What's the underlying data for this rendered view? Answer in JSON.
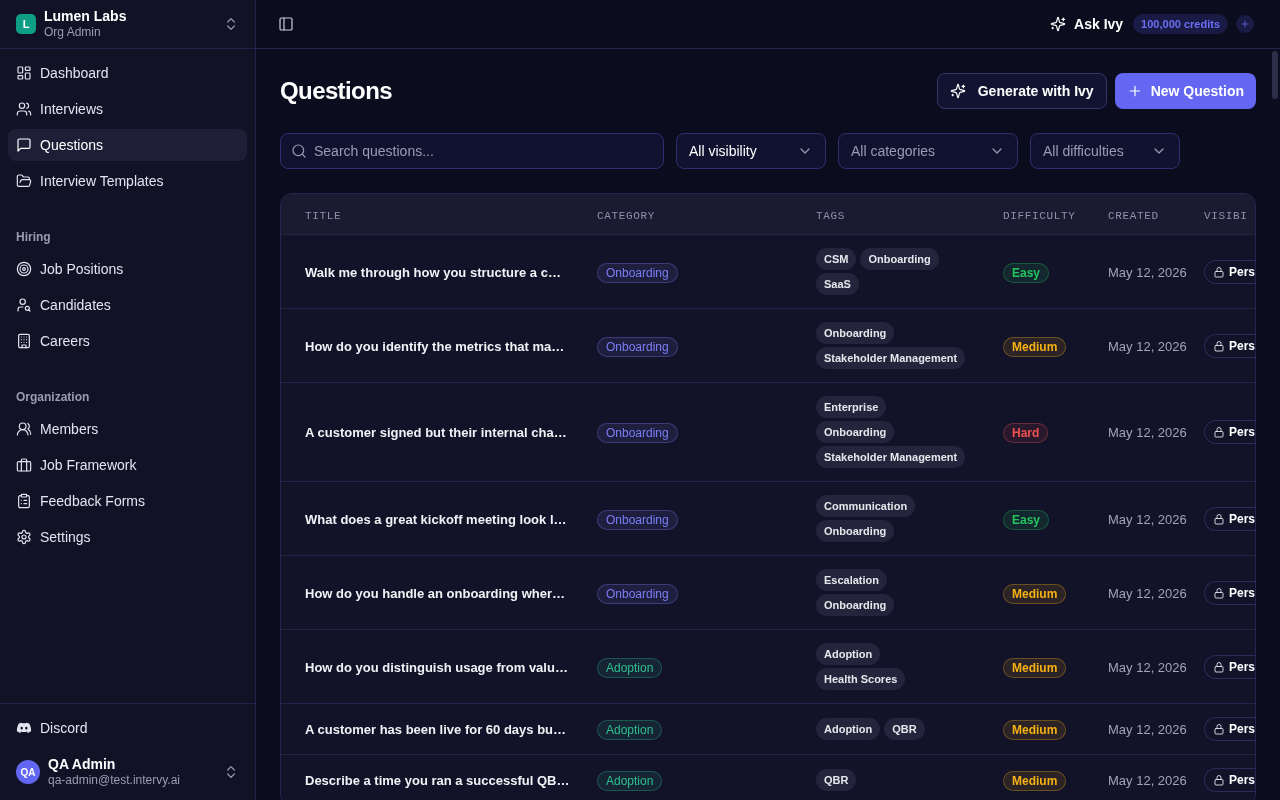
{
  "sidebar": {
    "org": {
      "initial": "L",
      "name": "Lumen Labs",
      "role": "Org Admin"
    },
    "sections": [
      {
        "items": [
          {
            "label": "Dashboard",
            "selected": false
          },
          {
            "label": "Interviews",
            "selected": false
          },
          {
            "label": "Questions",
            "selected": true
          },
          {
            "label": "Interview Templates",
            "selected": false
          }
        ]
      },
      {
        "title": "Hiring",
        "items": [
          {
            "label": "Job Positions",
            "selected": false
          },
          {
            "label": "Candidates",
            "selected": false
          },
          {
            "label": "Careers",
            "selected": false
          }
        ]
      },
      {
        "title": "Organization",
        "items": [
          {
            "label": "Members",
            "selected": false
          },
          {
            "label": "Job Framework",
            "selected": false
          },
          {
            "label": "Feedback Forms",
            "selected": false
          },
          {
            "label": "Settings",
            "selected": false
          }
        ]
      }
    ],
    "footer": {
      "link": "Discord",
      "user": {
        "initials": "QA",
        "name": "QA Admin",
        "email": "qa-admin@test.intervy.ai"
      }
    }
  },
  "top_bar": {
    "assistant": "Ask Ivy",
    "credits": "100,000 credits"
  },
  "page": {
    "title": "Questions",
    "actions": [
      {
        "label": "Generate with Ivy",
        "kind": "secondary"
      },
      {
        "label": "New Question",
        "kind": "primary"
      }
    ]
  },
  "filters": {
    "search": {
      "placeholder": "Search questions..."
    },
    "dropdowns": [
      {
        "value": "All visibility"
      },
      {
        "placeholder": "All categories"
      },
      {
        "placeholder": "All difficulties"
      }
    ]
  },
  "table": {
    "columns": [
      "TITLE",
      "CATEGORY",
      "TAGS",
      "DIFFICULTY",
      "CREATED",
      "VISIBI"
    ],
    "rows": [
      {
        "title": "Walk me through how you structure a c…",
        "category": {
          "label": "Onboarding",
          "color": "#7b7ef6"
        },
        "tags": [
          "CSM",
          "Onboarding",
          "SaaS"
        ],
        "difficulty": {
          "label": "Easy",
          "color": "#22c55e"
        },
        "created": "May 12, 2026",
        "visibility": "Pers"
      },
      {
        "title": "How do you identify the metrics that ma…",
        "category": {
          "label": "Onboarding",
          "color": "#7b7ef6"
        },
        "tags": [
          "Onboarding",
          "Stakeholder Management"
        ],
        "difficulty": {
          "label": "Medium",
          "color": "#f5b014"
        },
        "created": "May 12, 2026",
        "visibility": "Pers"
      },
      {
        "title": "A customer signed but their internal cha…",
        "category": {
          "label": "Onboarding",
          "color": "#7b7ef6"
        },
        "tags": [
          "Enterprise",
          "Onboarding",
          "Stakeholder Management"
        ],
        "difficulty": {
          "label": "Hard",
          "color": "#f05252"
        },
        "created": "May 12, 2026",
        "visibility": "Pers"
      },
      {
        "title": "What does a great kickoff meeting look l…",
        "category": {
          "label": "Onboarding",
          "color": "#7b7ef6"
        },
        "tags": [
          "Communication",
          "Onboarding"
        ],
        "difficulty": {
          "label": "Easy",
          "color": "#22c55e"
        },
        "created": "May 12, 2026",
        "visibility": "Pers"
      },
      {
        "title": "How do you handle an onboarding wher…",
        "category": {
          "label": "Onboarding",
          "color": "#7b7ef6"
        },
        "tags": [
          "Escalation",
          "Onboarding"
        ],
        "difficulty": {
          "label": "Medium",
          "color": "#f5b014"
        },
        "created": "May 12, 2026",
        "visibility": "Pers"
      },
      {
        "title": "How do you distinguish usage from valu…",
        "category": {
          "label": "Adoption",
          "color": "#2fbf8f"
        },
        "tags": [
          "Adoption",
          "Health Scores"
        ],
        "difficulty": {
          "label": "Medium",
          "color": "#f5b014"
        },
        "created": "May 12, 2026",
        "visibility": "Pers"
      },
      {
        "title": "A customer has been live for 60 days bu…",
        "category": {
          "label": "Adoption",
          "color": "#2fbf8f"
        },
        "tags": [
          "Adoption",
          "QBR"
        ],
        "difficulty": {
          "label": "Medium",
          "color": "#f5b014"
        },
        "created": "May 12, 2026",
        "visibility": "Pers"
      },
      {
        "title": "Describe a time you ran a successful QB…",
        "category": {
          "label": "Adoption",
          "color": "#2fbf8f"
        },
        "tags": [
          "QBR"
        ],
        "difficulty": {
          "label": "Medium",
          "color": "#f5b014"
        },
        "created": "May 12, 2026",
        "visibility": "Pers"
      }
    ]
  }
}
